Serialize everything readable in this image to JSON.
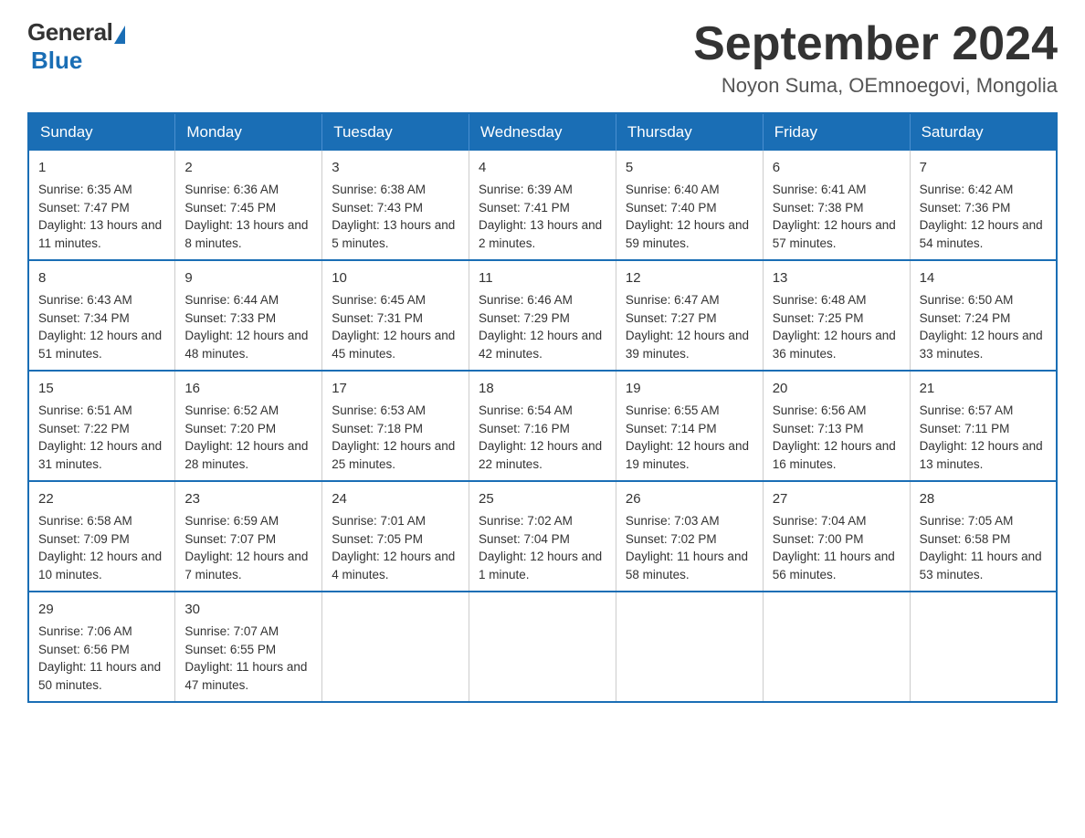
{
  "logo": {
    "general": "General",
    "blue": "Blue"
  },
  "title": "September 2024",
  "location": "Noyon Suma, OEmnoegovi, Mongolia",
  "days_of_week": [
    "Sunday",
    "Monday",
    "Tuesday",
    "Wednesday",
    "Thursday",
    "Friday",
    "Saturday"
  ],
  "weeks": [
    [
      {
        "day": 1,
        "sunrise": "6:35 AM",
        "sunset": "7:47 PM",
        "daylight": "13 hours and 11 minutes."
      },
      {
        "day": 2,
        "sunrise": "6:36 AM",
        "sunset": "7:45 PM",
        "daylight": "13 hours and 8 minutes."
      },
      {
        "day": 3,
        "sunrise": "6:38 AM",
        "sunset": "7:43 PM",
        "daylight": "13 hours and 5 minutes."
      },
      {
        "day": 4,
        "sunrise": "6:39 AM",
        "sunset": "7:41 PM",
        "daylight": "13 hours and 2 minutes."
      },
      {
        "day": 5,
        "sunrise": "6:40 AM",
        "sunset": "7:40 PM",
        "daylight": "12 hours and 59 minutes."
      },
      {
        "day": 6,
        "sunrise": "6:41 AM",
        "sunset": "7:38 PM",
        "daylight": "12 hours and 57 minutes."
      },
      {
        "day": 7,
        "sunrise": "6:42 AM",
        "sunset": "7:36 PM",
        "daylight": "12 hours and 54 minutes."
      }
    ],
    [
      {
        "day": 8,
        "sunrise": "6:43 AM",
        "sunset": "7:34 PM",
        "daylight": "12 hours and 51 minutes."
      },
      {
        "day": 9,
        "sunrise": "6:44 AM",
        "sunset": "7:33 PM",
        "daylight": "12 hours and 48 minutes."
      },
      {
        "day": 10,
        "sunrise": "6:45 AM",
        "sunset": "7:31 PM",
        "daylight": "12 hours and 45 minutes."
      },
      {
        "day": 11,
        "sunrise": "6:46 AM",
        "sunset": "7:29 PM",
        "daylight": "12 hours and 42 minutes."
      },
      {
        "day": 12,
        "sunrise": "6:47 AM",
        "sunset": "7:27 PM",
        "daylight": "12 hours and 39 minutes."
      },
      {
        "day": 13,
        "sunrise": "6:48 AM",
        "sunset": "7:25 PM",
        "daylight": "12 hours and 36 minutes."
      },
      {
        "day": 14,
        "sunrise": "6:50 AM",
        "sunset": "7:24 PM",
        "daylight": "12 hours and 33 minutes."
      }
    ],
    [
      {
        "day": 15,
        "sunrise": "6:51 AM",
        "sunset": "7:22 PM",
        "daylight": "12 hours and 31 minutes."
      },
      {
        "day": 16,
        "sunrise": "6:52 AM",
        "sunset": "7:20 PM",
        "daylight": "12 hours and 28 minutes."
      },
      {
        "day": 17,
        "sunrise": "6:53 AM",
        "sunset": "7:18 PM",
        "daylight": "12 hours and 25 minutes."
      },
      {
        "day": 18,
        "sunrise": "6:54 AM",
        "sunset": "7:16 PM",
        "daylight": "12 hours and 22 minutes."
      },
      {
        "day": 19,
        "sunrise": "6:55 AM",
        "sunset": "7:14 PM",
        "daylight": "12 hours and 19 minutes."
      },
      {
        "day": 20,
        "sunrise": "6:56 AM",
        "sunset": "7:13 PM",
        "daylight": "12 hours and 16 minutes."
      },
      {
        "day": 21,
        "sunrise": "6:57 AM",
        "sunset": "7:11 PM",
        "daylight": "12 hours and 13 minutes."
      }
    ],
    [
      {
        "day": 22,
        "sunrise": "6:58 AM",
        "sunset": "7:09 PM",
        "daylight": "12 hours and 10 minutes."
      },
      {
        "day": 23,
        "sunrise": "6:59 AM",
        "sunset": "7:07 PM",
        "daylight": "12 hours and 7 minutes."
      },
      {
        "day": 24,
        "sunrise": "7:01 AM",
        "sunset": "7:05 PM",
        "daylight": "12 hours and 4 minutes."
      },
      {
        "day": 25,
        "sunrise": "7:02 AM",
        "sunset": "7:04 PM",
        "daylight": "12 hours and 1 minute."
      },
      {
        "day": 26,
        "sunrise": "7:03 AM",
        "sunset": "7:02 PM",
        "daylight": "11 hours and 58 minutes."
      },
      {
        "day": 27,
        "sunrise": "7:04 AM",
        "sunset": "7:00 PM",
        "daylight": "11 hours and 56 minutes."
      },
      {
        "day": 28,
        "sunrise": "7:05 AM",
        "sunset": "6:58 PM",
        "daylight": "11 hours and 53 minutes."
      }
    ],
    [
      {
        "day": 29,
        "sunrise": "7:06 AM",
        "sunset": "6:56 PM",
        "daylight": "11 hours and 50 minutes."
      },
      {
        "day": 30,
        "sunrise": "7:07 AM",
        "sunset": "6:55 PM",
        "daylight": "11 hours and 47 minutes."
      },
      null,
      null,
      null,
      null,
      null
    ]
  ]
}
